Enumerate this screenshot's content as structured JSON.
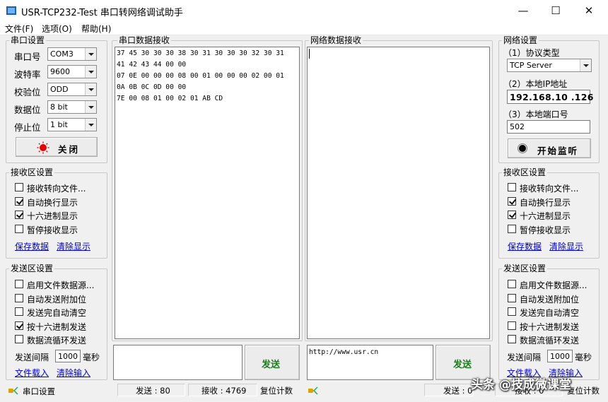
{
  "window": {
    "title": "USR-TCP232-Test 串口转网络调试助手",
    "minimize": "—",
    "maximize": "☐",
    "close": "✕"
  },
  "menu": [
    "文件(F)",
    "选项(O)",
    "帮助(H)"
  ],
  "serial_settings": {
    "legend": "串口设置",
    "fields": [
      {
        "label": "串口号",
        "value": "COM3"
      },
      {
        "label": "波特率",
        "value": "9600"
      },
      {
        "label": "校验位",
        "value": "ODD"
      },
      {
        "label": "数据位",
        "value": "8 bit"
      },
      {
        "label": "停止位",
        "value": "1 bit"
      }
    ],
    "close_button": "关闭"
  },
  "recv_settings_left": {
    "legend": "接收区设置",
    "options": [
      {
        "label": "接收转向文件...",
        "checked": false
      },
      {
        "label": "自动换行显示",
        "checked": true
      },
      {
        "label": "十六进制显示",
        "checked": true
      },
      {
        "label": "暂停接收显示",
        "checked": false
      }
    ],
    "save_link": "保存数据",
    "clear_link": "清除显示"
  },
  "send_settings_left": {
    "legend": "发送区设置",
    "options": [
      {
        "label": "启用文件数据源...",
        "checked": false
      },
      {
        "label": "自动发送附加位",
        "checked": false
      },
      {
        "label": "发送完自动清空",
        "checked": false
      },
      {
        "label": "按十六进制发送",
        "checked": true
      },
      {
        "label": "数据流循环发送",
        "checked": false
      }
    ],
    "interval_label": "发送间隔",
    "interval_value": "1000",
    "interval_unit": "毫秒",
    "load_link": "文件载入",
    "clear_link": "清除输入"
  },
  "serial_recv": {
    "legend": "串口数据接收",
    "lines": [
      "37 45 30 30 30 38 30 31 30 30 30 32 30 31",
      "41 42 43 44 00 00",
      "07 0E 00 00 00 08 00 01 00 00 00 02 00 01",
      "0A 0B 0C 0D 00 00",
      "7E 00 08 01 00 02 01 AB CD"
    ],
    "send_button": "发送"
  },
  "net_recv": {
    "legend": "网络数据接收",
    "send_text": "http://www.usr.cn",
    "send_button": "发送"
  },
  "net_settings": {
    "legend": "网络设置",
    "protocol_label": "（1）协议类型",
    "protocol_value": "TCP Server",
    "ip_label": "（2）本地IP地址",
    "ip_value": "192.168.10 .126",
    "port_label": "（3）本地端口号",
    "port_value": "502",
    "listen_button": "开始监听"
  },
  "recv_settings_right": {
    "legend": "接收区设置",
    "options": [
      {
        "label": "接收转向文件...",
        "checked": false
      },
      {
        "label": "自动换行显示",
        "checked": true
      },
      {
        "label": "十六进制显示",
        "checked": true
      },
      {
        "label": "暂停接收显示",
        "checked": false
      }
    ],
    "save_link": "保存数据",
    "clear_link": "清除显示"
  },
  "send_settings_right": {
    "legend": "发送区设置",
    "options": [
      {
        "label": "启用文件数据源...",
        "checked": false
      },
      {
        "label": "自动发送附加位",
        "checked": false
      },
      {
        "label": "发送完自动清空",
        "checked": false
      },
      {
        "label": "按十六进制发送",
        "checked": false
      },
      {
        "label": "数据流循环发送",
        "checked": false
      }
    ],
    "interval_label": "发送间隔",
    "interval_value": "1000",
    "interval_unit": "毫秒",
    "load_link": "文件载入",
    "clear_link": "清除输入"
  },
  "status": {
    "left_label": "串口设置",
    "send_count": "发送 : 80",
    "recv_count": "接收 : 4769",
    "reset": "复位计数",
    "right_send": "发送 : 0",
    "right_recv": "接收 : 0",
    "right_reset": "复位计数",
    "watermark": "头条 @技成微课堂"
  },
  "colors": {
    "accent_link": "#0000cc",
    "send_green": "#1f7a1f",
    "close_red": "#e00000"
  }
}
